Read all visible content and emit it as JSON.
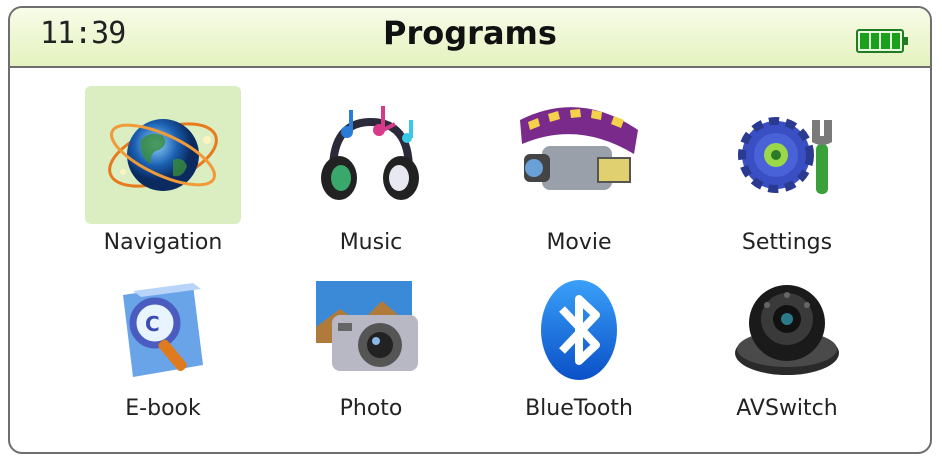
{
  "status": {
    "time": "11:39",
    "title": "Programs",
    "battery_level": 1.0
  },
  "colors": {
    "accent_bg": "#e4f2bf",
    "selected_bg": "#dbeec1",
    "battery": "#1aa01a"
  },
  "apps": [
    {
      "label": "Navigation",
      "icon": "globe-icon",
      "selected": true
    },
    {
      "label": "Music",
      "icon": "headphones-icon",
      "selected": false
    },
    {
      "label": "Movie",
      "icon": "camcorder-icon",
      "selected": false
    },
    {
      "label": "Settings",
      "icon": "gear-wrench-icon",
      "selected": false
    },
    {
      "label": "E-book",
      "icon": "book-magnifier-icon",
      "selected": false
    },
    {
      "label": "Photo",
      "icon": "camera-icon",
      "selected": false
    },
    {
      "label": "BlueTooth",
      "icon": "bluetooth-icon",
      "selected": false
    },
    {
      "label": "AVSwitch",
      "icon": "security-camera-icon",
      "selected": false
    }
  ]
}
